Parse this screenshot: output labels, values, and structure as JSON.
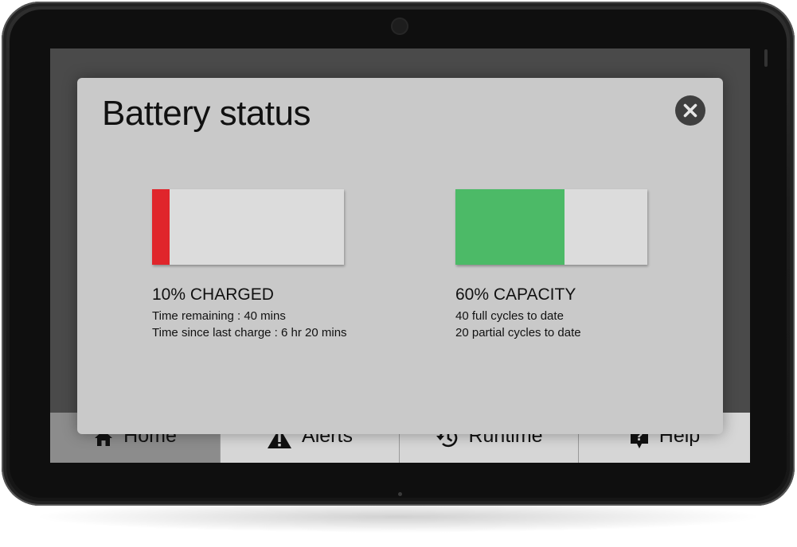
{
  "dialog": {
    "title": "Battery status",
    "close_icon": "close-icon"
  },
  "charge": {
    "level_percent": 10,
    "fill_color": "#e0252b",
    "heading": "10% CHARGED",
    "line1": "Time remaining : 40 mins",
    "line2": "Time since last charge : 6 hr 20 mins"
  },
  "capacity": {
    "level_percent": 60,
    "fill_color": "#4cba67",
    "heading": "60% CAPACITY",
    "line1": "40 full cycles to date",
    "line2": "20 partial cycles to date"
  },
  "nav": {
    "items": [
      {
        "label": "Home",
        "icon": "home-icon",
        "active": true
      },
      {
        "label": "Alerts",
        "icon": "warning-icon",
        "active": false
      },
      {
        "label": "Runtime",
        "icon": "history-icon",
        "active": false
      },
      {
        "label": "Help",
        "icon": "help-icon",
        "active": false
      }
    ]
  },
  "colors": {
    "dialog_background": "#c9c9c9",
    "bar_track": "#dcdcdc",
    "nav_active": "#8c8c8c",
    "nav_inactive": "#d6d6d6"
  }
}
